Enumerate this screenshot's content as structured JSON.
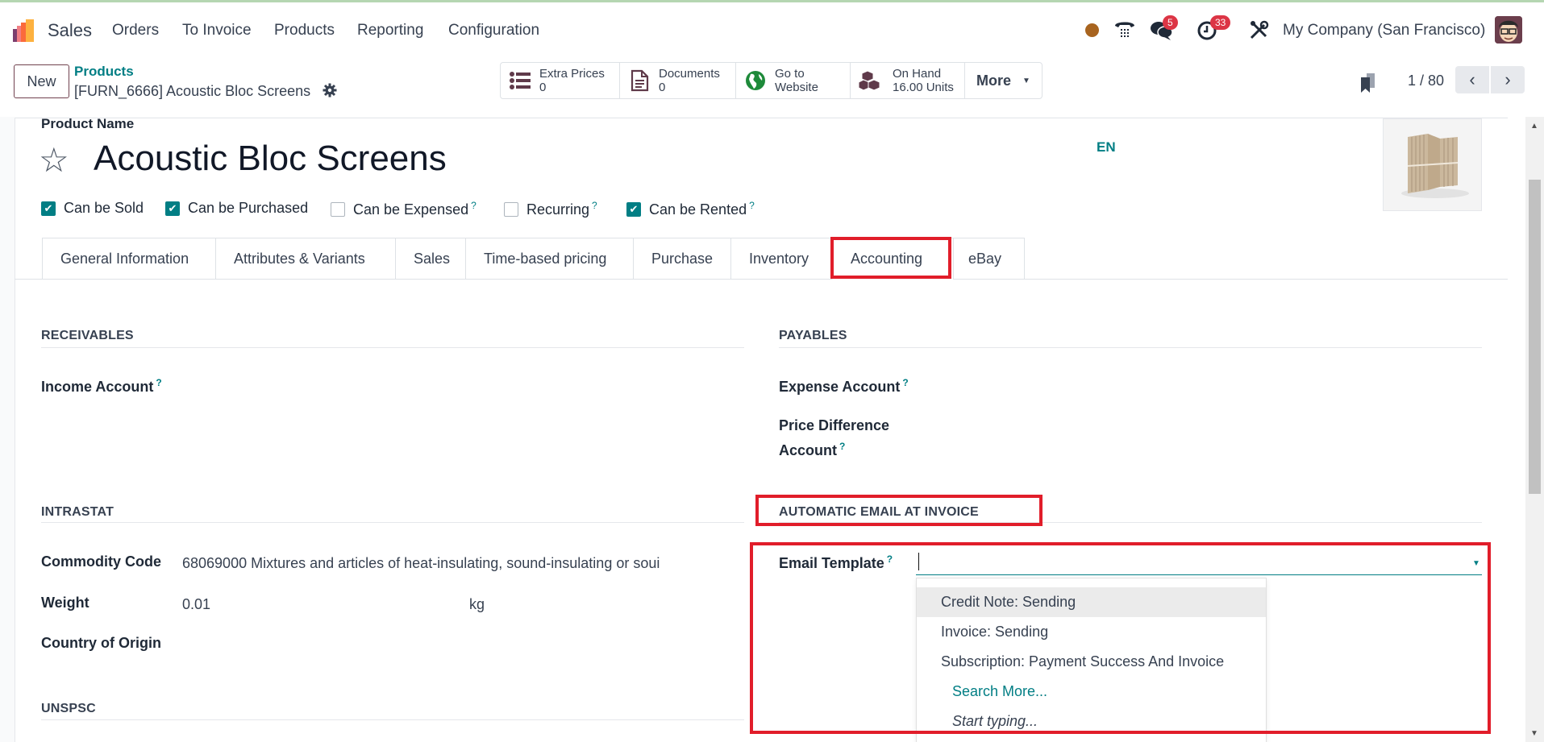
{
  "topbar": {
    "app_name": "Sales",
    "menu": [
      "Orders",
      "To Invoice",
      "Products",
      "Reporting",
      "Configuration"
    ],
    "messages_badge": "5",
    "activities_badge": "33",
    "company": "My Company (San Francisco)",
    "colors": {
      "status_dot": "#a8641f",
      "badge": "#dc3545"
    }
  },
  "control_panel": {
    "new_label": "New",
    "breadcrumb_parent": "Products",
    "breadcrumb_current": "[FURN_6666] Acoustic Bloc Screens",
    "smart_buttons": [
      {
        "label": "Extra Prices",
        "value": "0",
        "icon": "list-icon"
      },
      {
        "label": "Documents",
        "value": "0",
        "icon": "document-icon"
      },
      {
        "label": "Go to",
        "value": "Website",
        "icon": "globe-icon"
      },
      {
        "label": "On Hand",
        "value": "16.00 Units",
        "icon": "cubes-icon"
      }
    ],
    "more_label": "More",
    "pager": "1 / 80"
  },
  "form": {
    "product_name_label": "Product Name",
    "product_name": "Acoustic Bloc Screens",
    "lang": "EN",
    "checkboxes": [
      {
        "label": "Can be Sold",
        "checked": true,
        "tooltip": false
      },
      {
        "label": "Can be Purchased",
        "checked": true,
        "tooltip": false
      },
      {
        "label": "Can be Expensed",
        "checked": false,
        "tooltip": true
      },
      {
        "label": "Recurring",
        "checked": false,
        "tooltip": true
      },
      {
        "label": "Can be Rented",
        "checked": true,
        "tooltip": true
      }
    ],
    "tabs": [
      {
        "label": "General Information",
        "active": false
      },
      {
        "label": "Attributes & Variants",
        "active": false
      },
      {
        "label": "Sales",
        "active": false
      },
      {
        "label": "Time-based pricing",
        "active": false
      },
      {
        "label": "Purchase",
        "active": false
      },
      {
        "label": "Inventory",
        "active": false
      },
      {
        "label": "Accounting",
        "active": true
      },
      {
        "label": "eBay",
        "active": false
      }
    ],
    "receivables": {
      "heading": "RECEIVABLES",
      "income_account_label": "Income Account",
      "tooltip": "?"
    },
    "payables": {
      "heading": "PAYABLES",
      "expense_account_label": "Expense Account",
      "price_diff_label_1": "Price Difference",
      "price_diff_label_2": "Account",
      "tooltip": "?"
    },
    "intrastat": {
      "heading": "INTRASTAT",
      "commodity_label": "Commodity Code",
      "commodity_value": "68069000 Mixtures and articles of heat-insulating, sound-insulating or soui",
      "weight_label": "Weight",
      "weight_value": "0.01",
      "weight_unit": "kg",
      "country_label": "Country of Origin"
    },
    "unspsc": {
      "heading": "UNSPSC"
    },
    "auto_email": {
      "heading": "AUTOMATIC EMAIL AT INVOICE",
      "email_template_label": "Email Template",
      "email_template_value": "",
      "tooltip": "?",
      "dropdown": {
        "options": [
          "Credit Note: Sending",
          "Invoice: Sending",
          "Subscription: Payment Success And Invoice"
        ],
        "highlighted_index": 0,
        "search_more": "Search More...",
        "start_typing": "Start typing..."
      }
    }
  },
  "colors": {
    "accent": "#017e84",
    "brand": "#71424f",
    "highlight_box": "#e11d2a"
  }
}
